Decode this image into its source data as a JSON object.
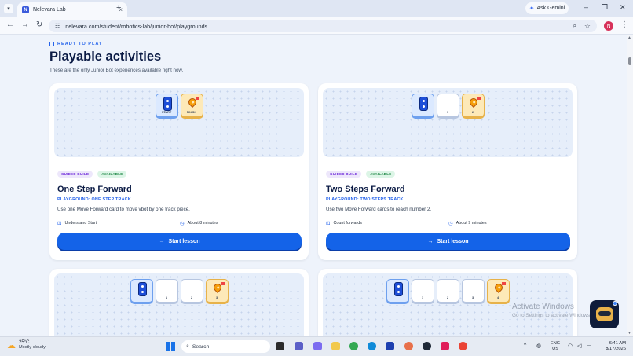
{
  "browser": {
    "tab_title": "Nelevara Lab",
    "tab_favicon": "N",
    "tab_close": "×",
    "new_tab": "+",
    "ask_gemini": "Ask Gemini",
    "url": "nelevara.com/student/robotics-lab/junior-bot/playgrounds",
    "profile_initial": "N"
  },
  "page": {
    "eyebrow": "READY TO PLAY",
    "title": "Playable activities",
    "subtitle": "These are the only Junior Bot experiences available right now."
  },
  "cards": [
    {
      "tag_guided": "GUIDED BUILD",
      "tag_available": "AVAILABLE",
      "title": "One Step Forward",
      "playground": "PLAYGROUND: ONE STEP TRACK",
      "description": "Use one Move Forward card to move vbot by one track piece.",
      "skill": "Understand Start",
      "duration": "About 8 minutes",
      "cta": "Start lesson",
      "tiles": [
        {
          "label": "START"
        },
        {
          "label": "FINISH"
        }
      ]
    },
    {
      "tag_guided": "GUIDED BUILD",
      "tag_available": "AVAILABLE",
      "title": "Two Steps Forward",
      "playground": "PLAYGROUND: TWO STEPS TRACK",
      "description": "Use two Move Forward cards to reach number 2.",
      "skill": "Count forwards",
      "duration": "About 9 minutes",
      "cta": "Start lesson",
      "tiles": [
        {
          "label": ""
        },
        {
          "label": "1"
        },
        {
          "label": "2"
        }
      ]
    },
    {
      "tiles": [
        {
          "label": ""
        },
        {
          "label": "1"
        },
        {
          "label": "2"
        },
        {
          "label": "3"
        }
      ]
    },
    {
      "tiles": [
        {
          "label": ""
        },
        {
          "label": "1"
        },
        {
          "label": "2"
        },
        {
          "label": "3"
        },
        {
          "label": "4"
        }
      ]
    }
  ],
  "overlay": {
    "activate_title": "Activate Windows",
    "activate_sub": "Go to Settings to activate Windows."
  },
  "taskbar": {
    "temperature": "25°C",
    "weather": "Mostly cloudy",
    "search_placeholder": "Search",
    "lang_line1": "ENG",
    "lang_line2": "US",
    "time": "6:41 AM",
    "date": "8/17/2026"
  },
  "colors": {
    "accent": "#1463e8",
    "heading": "#0b1b45",
    "page_bg": "#eef3fb"
  }
}
